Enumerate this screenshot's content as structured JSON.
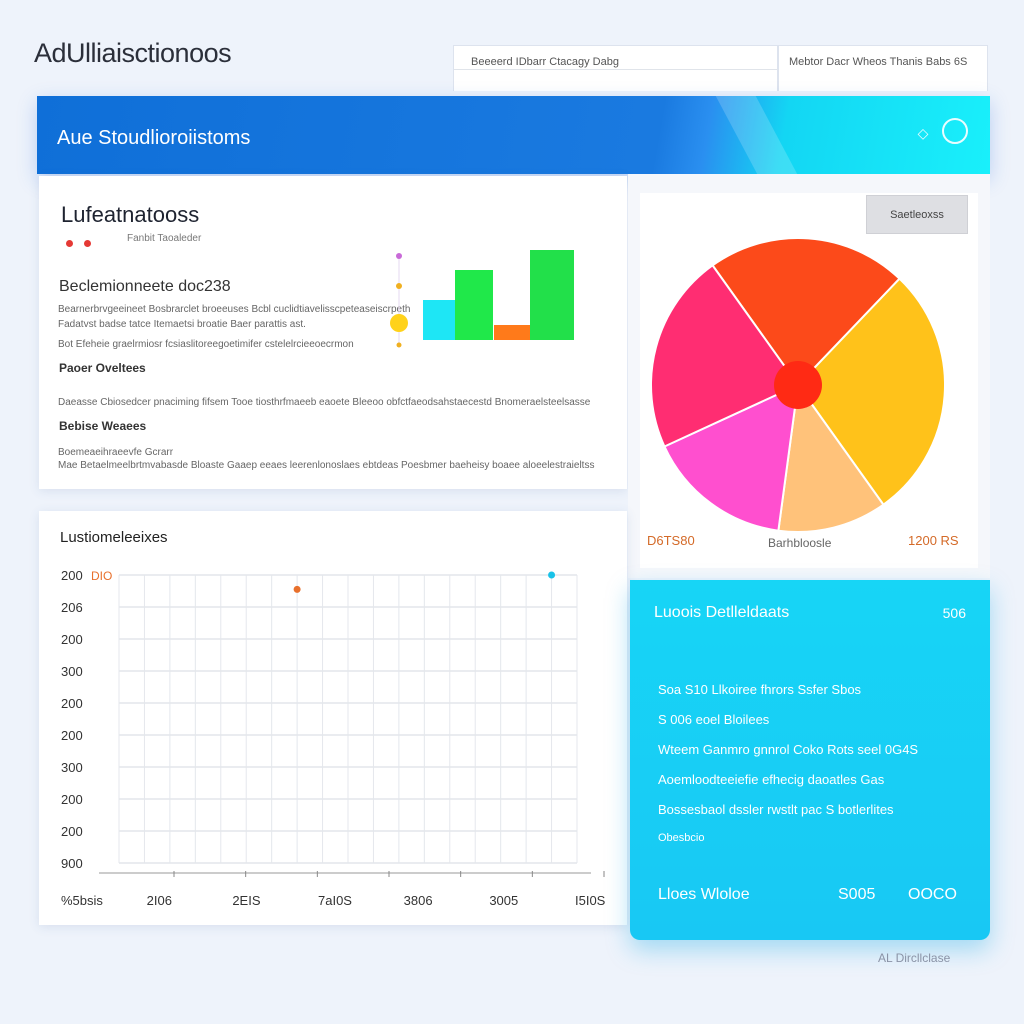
{
  "app": {
    "title": "AdUlliaisctionoos"
  },
  "topbar": {
    "left_text": "Beeeerd IDbarr Ctacagy   Dabg",
    "right_text": "Mebtor  Dacr  Wheos  Thanis   Babs  6S"
  },
  "header": {
    "title": "Aue Stoudlioroiistoms",
    "icon_a": "diamond-icon",
    "icon_b": "circle-icon"
  },
  "card1": {
    "title": "Lufeatnatooss",
    "tiny": "Fanbit Taoaleder",
    "subtitle": "Beclemionneete doc238",
    "lines": [
      "Bearnerbrvgeeineet Bosbrarclet broeeuses Bcbl  cuclidtiavelisscpeteaseiscrpeth",
      "Fadatvst badse tatce Itemaetsi broatie Baer  parattis ast.",
      "Bot  Efeheie graelrmiosr fcsiaslitoreegoetimifer  cstelelrcieeoecrmon"
    ],
    "heading_a": "Paoer Oveltees",
    "line_b": "Daeasse Cbiosedcer pnaciming fifsem Tooe tiosthrfmaeeb eaoete Bleeoo obfctfaeodsahstaecestd Bnomeraelsteelsasse",
    "heading_b": "Bebise Weaees",
    "lines_c": [
      "Boemeaeihraeevfe Gcrarr",
      "Mae Betaelmeelbrtmvabasde Bloaste Gaaep eeaes leerenlonoslaes ebtdeas  Poesbmer baeheisy boaee aloeelestraieltss"
    ]
  },
  "minichart": {
    "values": [
      4,
      7,
      1.5,
      9
    ],
    "colors": [
      "#1ee6f5",
      "#20e84a",
      "#ff7a1a",
      "#22e04a"
    ]
  },
  "pie": {
    "button": "Saetleoxss",
    "left_label": "D6TS80",
    "center_label": "Barhbloosle",
    "right_label": "1200 RS",
    "slices": [
      {
        "value": 22,
        "color": "#fc4a1a"
      },
      {
        "value": 28,
        "color": "#ffc21a"
      },
      {
        "value": 12,
        "color": "#ffc27a"
      },
      {
        "value": 16,
        "color": "#ff4fcf"
      },
      {
        "value": 22,
        "color": "#ff2d72"
      }
    ],
    "center_color": "#ff2a14"
  },
  "line_chart": {
    "title": "Lustiomeleeixes",
    "orange_label": "DIO",
    "ytick_labels": [
      "200",
      "206",
      "200",
      "300",
      "200",
      "200",
      "300",
      "200",
      "200",
      "900"
    ],
    "xtick_labels": [
      "%5bsis",
      "2I06",
      "2EIS",
      "7aI0S",
      "3806",
      "3005",
      "I5I0S"
    ],
    "points": [
      {
        "series": "orange",
        "x": 7,
        "y": 0.45,
        "color": "#e8702c"
      },
      {
        "series": "cyan",
        "x": 17,
        "y": 0.0,
        "color": "#18c2e8"
      }
    ]
  },
  "cyan_panel": {
    "title": "Luoois Detlleldaats",
    "title_right": "506",
    "lines": [
      "Soa S10 Llkoiree fhrors Ssfer  Sbos",
      "S  006  eoel  Bloilees",
      "Wteem Ganmro gnnrol Coko Rots  seel 0G4S",
      "Aoemloodteeiefie efhecig daoatles Gas",
      "Bossesbaol dssler  rwstlt pac  S botlerlites",
      "Obesbcio"
    ],
    "foot_left": "Lloes  Wloloe",
    "foot_mid": "S005",
    "foot_right": "OOCO"
  },
  "watermark": "AL Dircllclase"
}
